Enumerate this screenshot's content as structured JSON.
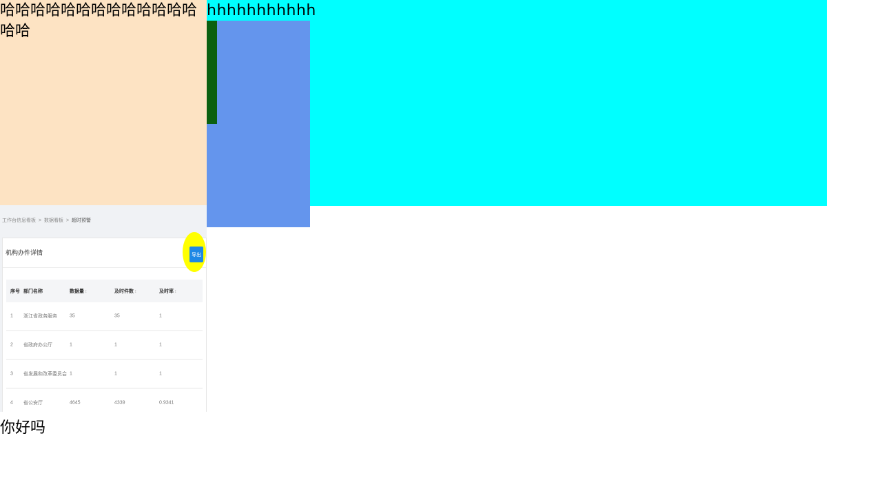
{
  "top_left_text": "哈哈哈哈哈哈哈哈哈哈哈哈哈哈哈",
  "top_right_text": "hhhhhhhhhhh",
  "bottom_text": "你好吗",
  "screenshot": {
    "breadcrumb": [
      "工作台信息看板",
      "数据看板",
      "超时预警"
    ],
    "breadcrumb_sep": ">",
    "card_title": "机构办件详情",
    "export_label": "导出",
    "table": {
      "headers": [
        "序号",
        "部门名称",
        "数据量",
        "及时件数",
        "及时率"
      ],
      "sort_mark": "↕",
      "rows": [
        [
          "1",
          "浙江省政务服务",
          "35",
          "35",
          "1"
        ],
        [
          "2",
          "省政府办公厅",
          "1",
          "1",
          "1"
        ],
        [
          "3",
          "省发展和改革委员会",
          "1",
          "1",
          "1"
        ],
        [
          "4",
          "省公安厅",
          "4645",
          "4339",
          "0.9341"
        ]
      ]
    }
  },
  "colors": {
    "peach": "#fde3c3",
    "cyan": "#00ffff",
    "cornflower": "#6495ed",
    "dark_green": "#0b6010",
    "highlight": "#ffff00",
    "button": "#1e88e5"
  }
}
